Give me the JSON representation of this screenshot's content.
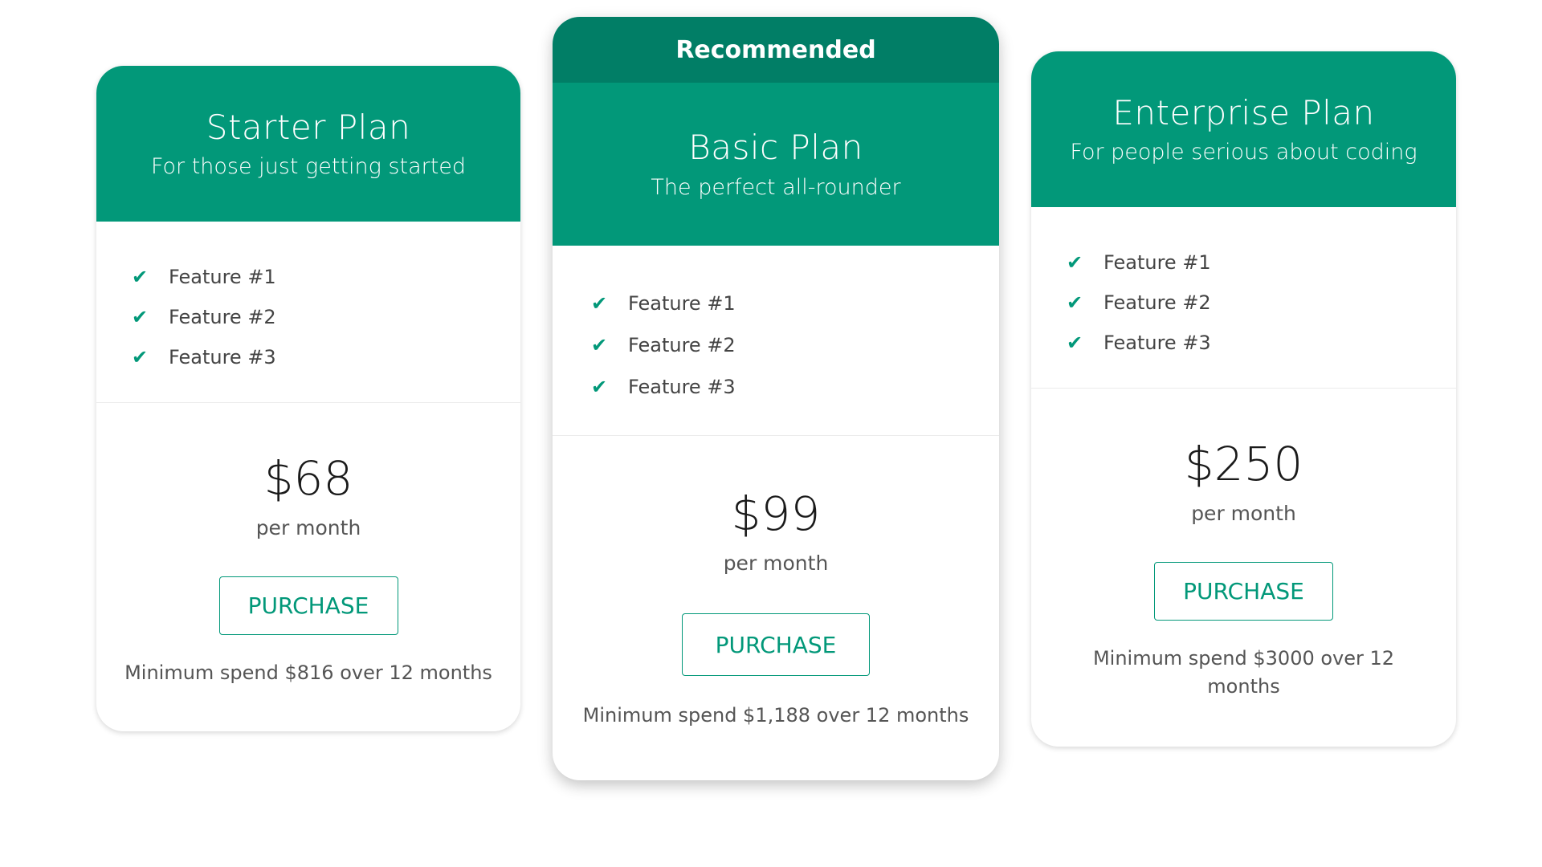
{
  "colors": {
    "header": "#029879",
    "ribbon": "#017e66",
    "accent": "#029879",
    "background": "#ffffff"
  },
  "plans": [
    {
      "name": "Starter Plan",
      "tagline": "For those just getting started",
      "features": [
        "Feature #1",
        "Feature #2",
        "Feature #3"
      ],
      "price": "$68",
      "period": "per month",
      "button_label": "PURCHASE",
      "min_spend": "Minimum spend $816 over 12 months"
    },
    {
      "ribbon": "Recommended",
      "name": "Basic Plan",
      "tagline": "The perfect all-rounder",
      "features": [
        "Feature #1",
        "Feature #2",
        "Feature #3"
      ],
      "price": "$99",
      "period": "per month",
      "button_label": "PURCHASE",
      "min_spend": "Minimum spend $1,188 over 12 months"
    },
    {
      "name": "Enterprise Plan",
      "tagline": "For people serious about coding",
      "features": [
        "Feature #1",
        "Feature #2",
        "Feature #3"
      ],
      "price": "$250",
      "period": "per month",
      "button_label": "PURCHASE",
      "min_spend": "Minimum spend $3000 over 12 months"
    }
  ],
  "icons": {
    "feature_check": "check-icon"
  }
}
